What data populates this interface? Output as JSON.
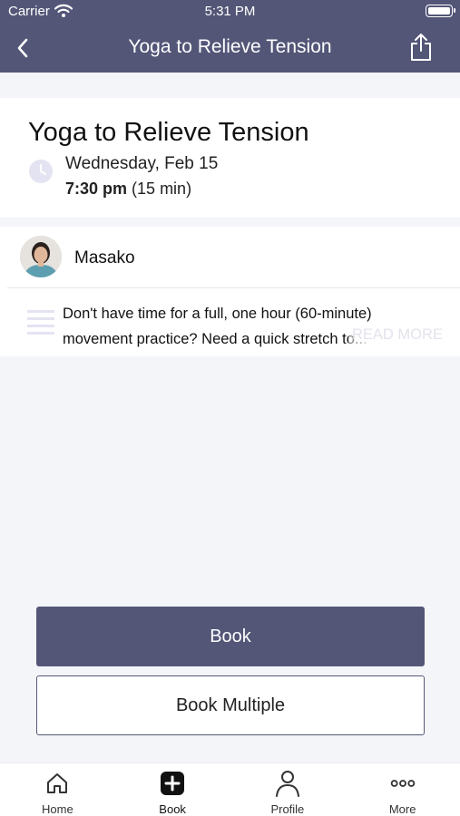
{
  "status_bar": {
    "carrier": "Carrier",
    "time": "5:31 PM"
  },
  "nav": {
    "title": "Yoga to Relieve Tension",
    "back_icon": "chevron-left-icon",
    "share_icon": "share-icon"
  },
  "class": {
    "title": "Yoga to Relieve Tension",
    "date": "Wednesday, Feb 15",
    "time": "7:30 pm",
    "duration": "(15 min)"
  },
  "teacher": {
    "name": "Masako"
  },
  "description": {
    "text": "Don't have time for a full, one hour (60-minute) movement practice? Need a quick stretch to...",
    "read_more": "READ MORE"
  },
  "actions": {
    "book_label": "Book",
    "book_multiple_label": "Book Multiple"
  },
  "tabs": [
    {
      "label": "Home",
      "icon": "home-icon"
    },
    {
      "label": "Book",
      "icon": "plus-square-icon"
    },
    {
      "label": "Profile",
      "icon": "person-icon"
    },
    {
      "label": "More",
      "icon": "more-dots-icon"
    }
  ],
  "colors": {
    "header": "#535677",
    "accent_light": "#e3e3f2",
    "background": "#f4f5f9"
  }
}
